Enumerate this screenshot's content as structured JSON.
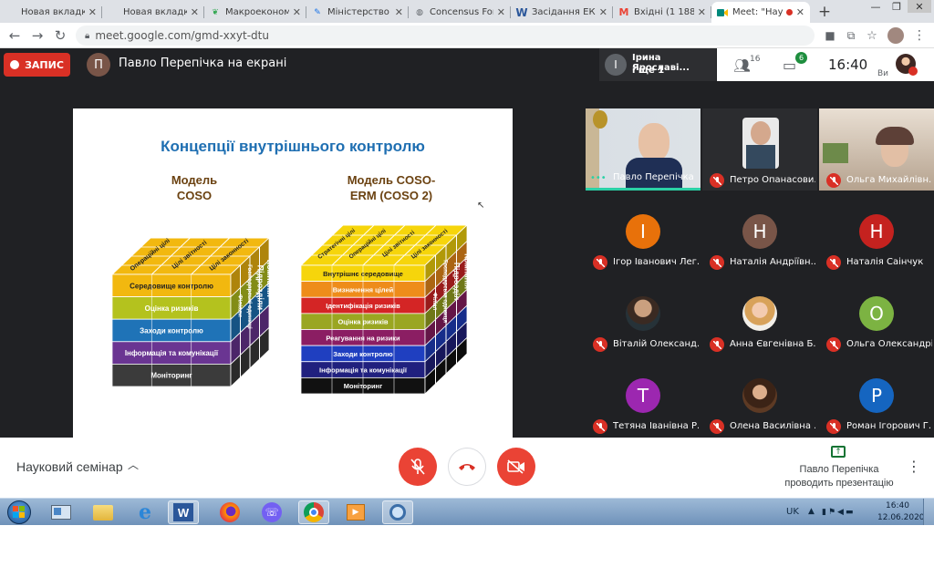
{
  "tabs": [
    {
      "label": "Новая вкладка",
      "icon": "page-icon",
      "color": "#888888"
    },
    {
      "label": "Новая вкладка",
      "icon": "page-icon",
      "color": "#888888"
    },
    {
      "label": "Макроекономі",
      "icon": "leaf-icon",
      "color": "#34a853"
    },
    {
      "label": "Міністерство р",
      "icon": "feather-icon",
      "color": "#1a73e8"
    },
    {
      "label": "Concensus Fore",
      "icon": "globe-icon",
      "color": "#5f6368"
    },
    {
      "label": "Засідання ЕК -",
      "icon": "word-icon",
      "color": "#2b579a"
    },
    {
      "label": "Вхідні (1 188) -",
      "icon": "gmail-icon",
      "color": "#ea4335"
    },
    {
      "label": "Meet: \"Нау",
      "icon": "meet-icon",
      "color": "#00897b"
    }
  ],
  "new_tab": "+",
  "url": "meet.google.com/gmd-xxyt-dtu",
  "header": {
    "rec_label": "ЗАПИС",
    "presenter_initial": "П",
    "presenter_text": "Павло Перепічка на екрані",
    "others_initial": "І",
    "others_name": "Ірина Ярославі...",
    "others_more": "і ще 1",
    "people_count": "16",
    "chat_count": "6",
    "time": "16:40",
    "self_label": "Ви"
  },
  "slide": {
    "title": "Концепції внутрішнього контролю",
    "left_heading_1": "Модель",
    "left_heading_2": "COSO",
    "right_heading_1": "Модель COSO-",
    "right_heading_2": "ERM (COSO 2)",
    "left_rows": [
      "Середовище контролю",
      "Оцінка ризиків",
      "Заходи контролю",
      "Інформація та комунікації",
      "Моніторинг"
    ],
    "left_top": [
      "Операційні цілі",
      "Цілі звітності",
      "Цілі законності"
    ],
    "left_side": [
      "Філіали",
      "Господарські одиниці",
      "Підрозділи",
      "Компанія"
    ],
    "right_rows": [
      "Внутрішнє середовище",
      "Визначення цілей",
      "Ідентифікація ризиків",
      "Оцінка ризиків",
      "Реагування на ризики",
      "Заходи контролю",
      "Інформація та комунікації",
      "Моніторинг"
    ],
    "right_top": [
      "Стратегічні цілі",
      "Операційні цілі",
      "Цілі звітності",
      "Цілі законності"
    ],
    "right_side": [
      "Філіал",
      "Господарська одиниця",
      "Підрозділ",
      "Компанія"
    ],
    "left_colors": [
      "#f2b80f",
      "#b4c21e",
      "#1f73b7",
      "#6a3592",
      "#3b3b3b"
    ],
    "right_colors": [
      "#f6d50b",
      "#ee8c1a",
      "#d42525",
      "#9aa622",
      "#8b1e63",
      "#1f3fc0",
      "#20207e",
      "#111111"
    ]
  },
  "participants": [
    {
      "name": "Павло Перепічка",
      "type": "video",
      "active": true
    },
    {
      "name": "Петро Опанасови...",
      "type": "video"
    },
    {
      "name": "Ольга Михайлівн...",
      "type": "video"
    },
    {
      "name": "Ігор Іванович Лег...",
      "type": "initial",
      "initial": "І",
      "color": "#e8710a"
    },
    {
      "name": "Наталія Андріївн...",
      "type": "initial",
      "initial": "Н",
      "color": "#795548"
    },
    {
      "name": "Наталія Саінчук",
      "type": "initial",
      "initial": "Н",
      "color": "#c5221f"
    },
    {
      "name": "Віталій Олександ...",
      "type": "photo"
    },
    {
      "name": "Анна Євгенівна Б...",
      "type": "photo"
    },
    {
      "name": "Ольга Олександрі...",
      "type": "initial",
      "initial": "О",
      "color": "#7cb342"
    },
    {
      "name": "Тетяна Іванівна Р...",
      "type": "initial",
      "initial": "Т",
      "color": "#9c27b0"
    },
    {
      "name": "Олена Василівна ...",
      "type": "photo"
    },
    {
      "name": "Роман Ігорович Г...",
      "type": "initial",
      "initial": "Р",
      "color": "#1565c0"
    }
  ],
  "bottom": {
    "meeting_name": "Науковий семінар",
    "presenting_1": "Павло Перепічка",
    "presenting_2": "проводить презентацію"
  },
  "taskbar": {
    "lang": "UK",
    "time": "16:40",
    "date": "12.06.2020",
    "apps": [
      "start-orb-icon",
      "app-window-icon",
      "file-explorer-icon",
      "internet-explorer-icon",
      "word-icon",
      "firefox-icon",
      "viber-icon",
      "chrome-icon",
      "media-player-icon",
      "search-tool-icon"
    ]
  }
}
